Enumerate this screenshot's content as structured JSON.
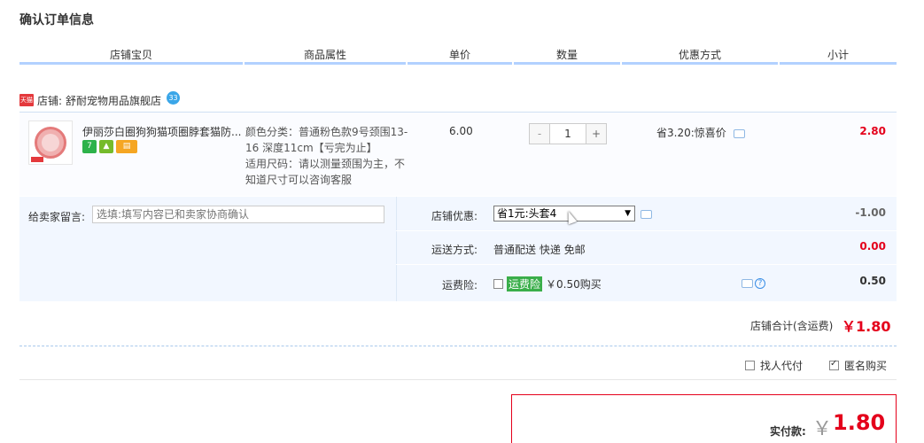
{
  "page": {
    "title": "确认订单信息"
  },
  "columns": [
    "店铺宝贝",
    "商品属性",
    "单价",
    "数量",
    "优惠方式",
    "小计"
  ],
  "shop": {
    "badge": "天猫",
    "label": "店铺:",
    "name": "舒耐宠物用品旗舰店",
    "chat_badge": "33"
  },
  "item": {
    "title": "伊丽莎白圈狗狗猫项圈脖套猫防...",
    "service_icons": [
      "seven-day-return-icon",
      "guarantee-shield-icon",
      "credit-card-icon"
    ],
    "service_labels": {
      "seven": "7"
    },
    "attr_color": "颜色分类：普通粉色款9号颈围13-16 深度11cm【亏完为止】",
    "attr_size": "适用尺码：请以测量颈围为主，不知道尺寸可以咨询客服",
    "unit_price": "6.00",
    "quantity": "1",
    "qty_minus": "-",
    "qty_plus": "+",
    "discount": "省3.20:惊喜价",
    "subtotal": "2.80"
  },
  "options": {
    "memo_label": "给卖家留言:",
    "memo_placeholder": "选填:填写内容已和卖家协商确认",
    "shop_discount_label": "店铺优惠:",
    "shop_discount_selected": "省1元:头套4",
    "shop_discount_value": "-1.00",
    "shipping_label": "运送方式:",
    "shipping_value": "普通配送 快递 免邮",
    "shipping_cost": "0.00",
    "insurance_label": "运费险:",
    "insurance_tag": "运费险",
    "insurance_price": "￥0.50购买",
    "insurance_cost": "0.50"
  },
  "shop_total": {
    "label": "店铺合计(含运费)",
    "value": "￥1.80"
  },
  "payment_options": {
    "proxy_pay": "找人代付",
    "anonymous": "匿名购买"
  },
  "final": {
    "label": "实付款:",
    "yen": "￥",
    "amount": "1.80"
  },
  "colors": {
    "accent_blue": "#b2d1ff",
    "price_red": "#e4001b",
    "option_bg": "#f2f7ff"
  }
}
